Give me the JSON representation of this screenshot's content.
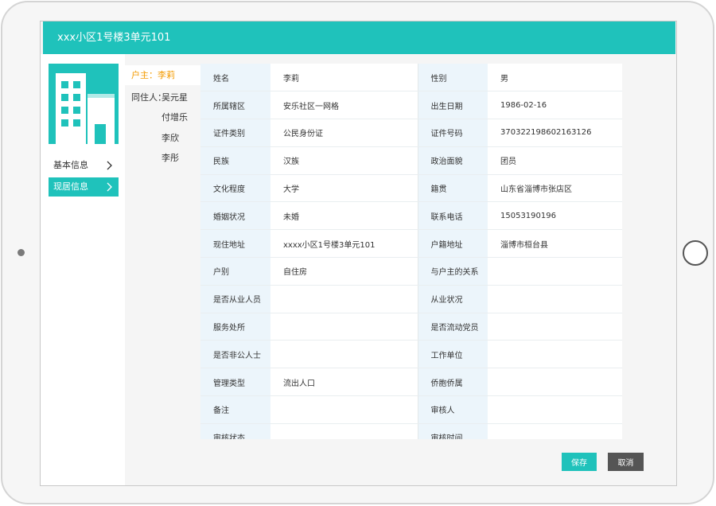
{
  "dialog": {
    "title": "xxx小区1号楼3单元101"
  },
  "nav": {
    "basic_info": "基本信息",
    "residence_info": "现居信息"
  },
  "members": {
    "owner": "户主：李莉",
    "cohabitant_prefix": "同住人：",
    "cohabitants": [
      "吴元星",
      "付增乐",
      "李欣",
      "李彤"
    ]
  },
  "info_rows": [
    [
      {
        "label": "姓名",
        "value": "李莉"
      },
      {
        "label": "性别",
        "value": "男"
      }
    ],
    [
      {
        "label": "所属辖区",
        "value": "安乐社区一网格"
      },
      {
        "label": "出生日期",
        "value": "1986-02-16"
      }
    ],
    [
      {
        "label": "证件类别",
        "value": "公民身份证"
      },
      {
        "label": "证件号码",
        "value": "370322198602163126"
      }
    ],
    [
      {
        "label": "民族",
        "value": "汉族"
      },
      {
        "label": "政治面貌",
        "value": "团员"
      }
    ],
    [
      {
        "label": "文化程度",
        "value": "大学"
      },
      {
        "label": "籍贯",
        "value": "山东省淄博市张店区"
      }
    ],
    [
      {
        "label": "婚姻状况",
        "value": "未婚"
      },
      {
        "label": "联系电话",
        "value": "15053190196"
      }
    ],
    [
      {
        "label": "现住地址",
        "value": "xxxx小区1号楼3单元101"
      },
      {
        "label": "户籍地址",
        "value": "淄博市桓台县"
      }
    ],
    [
      {
        "label": "户别",
        "value": "自住房"
      },
      {
        "label": "与户主的关系",
        "value": ""
      }
    ],
    [
      {
        "label": "是否从业人员",
        "value": ""
      },
      {
        "label": "从业状况",
        "value": ""
      }
    ],
    [
      {
        "label": "服务处所",
        "value": ""
      },
      {
        "label": "是否流动党员",
        "value": ""
      }
    ],
    [
      {
        "label": "是否非公人士",
        "value": ""
      },
      {
        "label": "工作单位",
        "value": ""
      }
    ],
    [
      {
        "label": "管理类型",
        "value": "流出人口"
      },
      {
        "label": "侨胞侨属",
        "value": ""
      }
    ],
    [
      {
        "label": "备注",
        "value": ""
      },
      {
        "label": "审核人",
        "value": ""
      }
    ],
    [
      {
        "label": "审核状态",
        "value": ""
      },
      {
        "label": "审核时间",
        "value": ""
      }
    ]
  ],
  "buttons": {
    "save": "保存",
    "cancel": "取消"
  },
  "colors": {
    "accent": "#1fc2bb",
    "owner_highlight": "#f39b00",
    "cancel": "#555555",
    "label_bg": "#ecf5fb"
  },
  "icons": {
    "building": "building-icon",
    "chevron": "chevron-right-icon"
  }
}
